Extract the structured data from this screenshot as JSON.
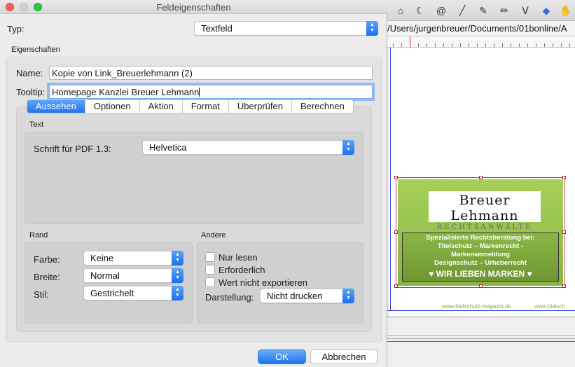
{
  "window": {
    "title": "Feldeigenschaften"
  },
  "type_row": {
    "label": "Typ:",
    "value": "Textfeld"
  },
  "properties": {
    "section_label": "Eigenschaften",
    "name_label": "Name:",
    "name_value": "Kopie von Link_Breuerlehmann (2)",
    "tooltip_label": "Tooltip:",
    "tooltip_value": "Homepage Kanzlei Breuer Lehmann"
  },
  "tabs": [
    {
      "label": "Aussehen",
      "active": true
    },
    {
      "label": "Optionen",
      "active": false
    },
    {
      "label": "Aktion",
      "active": false
    },
    {
      "label": "Format",
      "active": false
    },
    {
      "label": "Überprüfen",
      "active": false
    },
    {
      "label": "Berechnen",
      "active": false
    }
  ],
  "text_section": {
    "label": "Text",
    "font_label": "Schrift für PDF 1.3:",
    "font_value": "Helvetica"
  },
  "rand": {
    "label": "Rand",
    "farbe_label": "Farbe:",
    "farbe_value": "Keine",
    "breite_label": "Breite:",
    "breite_value": "Normal",
    "stil_label": "Stil:",
    "stil_value": "Gestrichelt"
  },
  "andere": {
    "label": "Andere",
    "nur_lesen": "Nur lesen",
    "erforderlich": "Erforderlich",
    "nicht_exportieren": "Wert nicht exportieren",
    "darstellung_label": "Darstellung:",
    "darstellung_value": "Nicht drucken"
  },
  "buttons": {
    "ok": "OK",
    "cancel": "Abbrechen"
  },
  "background_doc": {
    "path": "/Users/jurgenbreuer/Documents/01bonline/A",
    "logo_name": "Breuer Lehmann",
    "logo_sub": "RECHTSANWÄLTE",
    "ad_line1": "Spezialisierte Rechtsberatung bei:",
    "ad_line2": "Titelschutz – Markenrecht -",
    "ad_line3": "Markenanmeldung",
    "ad_line4": "Designschutz – Urheberrecht",
    "ad_slogan": "♥ WIR LIEBEN MARKEN ♥",
    "footer_url": "www.titelschutz-magazin.de",
    "footer_url2": "www.titelsch"
  },
  "colors": {
    "accent": "#2475ee",
    "ad_green": "#8ab847",
    "url_green": "#7cb342"
  },
  "icons": [
    "house-icon",
    "moon-icon",
    "spiral-icon",
    "line-icon",
    "highlighter-icon",
    "pencil-icon",
    "stamp-icon",
    "eraser-icon",
    "hand-icon"
  ]
}
